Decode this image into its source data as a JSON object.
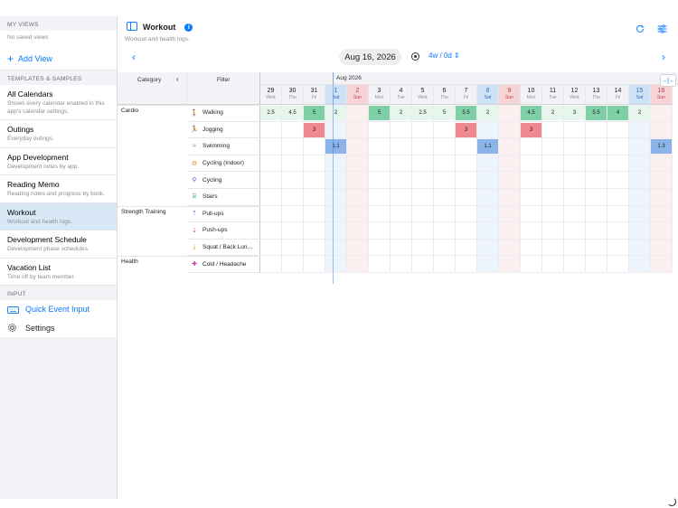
{
  "sidebar": {
    "my_views_header": "MY VIEWS",
    "no_saved_views": "No saved views",
    "add_view": "Add View",
    "templates_header": "TEMPLATES & SAMPLES",
    "items": [
      {
        "name": "All Calendars",
        "desc": "Shows every calendar enabled in this app's calendar settings."
      },
      {
        "name": "Outings",
        "desc": "Everyday outings."
      },
      {
        "name": "App Development",
        "desc": "Development notes by app."
      },
      {
        "name": "Reading Memo",
        "desc": "Reading notes and progress by book."
      },
      {
        "name": "Workout",
        "desc": "Workout and health logs."
      },
      {
        "name": "Development Schedule",
        "desc": "Development phase schedules."
      },
      {
        "name": "Vacation List",
        "desc": "Time off by team member."
      }
    ],
    "selected_index": 4,
    "input_header": "INPUT",
    "quick_event_input": "Quick Event Input",
    "settings": "Settings"
  },
  "header": {
    "title": "Workout",
    "subtitle": "Workout and health logs.",
    "date": "Aug 16, 2026",
    "range": "4w / 0d",
    "icons": [
      "sidebar-toggle-icon",
      "info-icon",
      "refresh-icon",
      "filter-settings-icon"
    ]
  },
  "grid": {
    "category_header": "Category",
    "filter_header": "Filter",
    "month_label": "Aug 2026",
    "days": [
      {
        "num": "29",
        "wd": "Wed",
        "type": "weekday"
      },
      {
        "num": "30",
        "wd": "Thu",
        "type": "weekday"
      },
      {
        "num": "31",
        "wd": "Fri",
        "type": "weekday"
      },
      {
        "num": "1",
        "wd": "Sat",
        "type": "sat"
      },
      {
        "num": "2",
        "wd": "Sun",
        "type": "sun"
      },
      {
        "num": "3",
        "wd": "Mon",
        "type": "weekday"
      },
      {
        "num": "4",
        "wd": "Tue",
        "type": "weekday"
      },
      {
        "num": "5",
        "wd": "Wed",
        "type": "weekday"
      },
      {
        "num": "6",
        "wd": "Thu",
        "type": "weekday"
      },
      {
        "num": "7",
        "wd": "Fri",
        "type": "weekday"
      },
      {
        "num": "8",
        "wd": "Sat",
        "type": "sat"
      },
      {
        "num": "9",
        "wd": "Sun",
        "type": "sun"
      },
      {
        "num": "10",
        "wd": "Mon",
        "type": "weekday"
      },
      {
        "num": "11",
        "wd": "Tue",
        "type": "weekday"
      },
      {
        "num": "12",
        "wd": "Wed",
        "type": "weekday"
      },
      {
        "num": "13",
        "wd": "Thu",
        "type": "weekday"
      },
      {
        "num": "14",
        "wd": "Fri",
        "type": "weekday"
      },
      {
        "num": "15",
        "wd": "Sat",
        "type": "sat"
      },
      {
        "num": "16",
        "wd": "Sun",
        "type": "sun"
      }
    ],
    "rows": [
      {
        "category": "Cardio",
        "filter": "Walking",
        "icon": "walking-icon",
        "icon_color": "#2a9d63"
      },
      {
        "category": "",
        "filter": "Jogging",
        "icon": "running-icon",
        "icon_color": "#e0484f"
      },
      {
        "category": "",
        "filter": "Swimming",
        "icon": "swimming-icon",
        "icon_color": "#3b7fd6"
      },
      {
        "category": "",
        "filter": "Cycling (Indoor)",
        "icon": "indoor-cycling-icon",
        "icon_color": "#e8902a"
      },
      {
        "category": "",
        "filter": "Cycling",
        "icon": "bicycle-icon",
        "icon_color": "#7b4bd6"
      },
      {
        "category": "",
        "filter": "Stairs",
        "icon": "stairs-icon",
        "icon_color": "#2a9d63"
      },
      {
        "category": "Strength Training",
        "filter": "Pull-ups",
        "icon": "pullup-icon",
        "icon_color": "#3b7fd6"
      },
      {
        "category": "",
        "filter": "Push-ups",
        "icon": "pushup-icon",
        "icon_color": "#e0484f"
      },
      {
        "category": "",
        "filter": "Squat / Back Lun…",
        "icon": "squat-icon",
        "icon_color": "#e8902a"
      },
      {
        "category": "Health",
        "filter": "Cold / Headache",
        "icon": "medical-kit-icon",
        "icon_color": "#c0399a"
      }
    ],
    "events": [
      {
        "row": 0,
        "day": 0,
        "value": "2.5",
        "color": "greenlite"
      },
      {
        "row": 0,
        "day": 1,
        "value": "4.5",
        "color": "greenlite"
      },
      {
        "row": 0,
        "day": 2,
        "value": "5",
        "color": "green"
      },
      {
        "row": 0,
        "day": 3,
        "value": "2",
        "color": "greenlite"
      },
      {
        "row": 0,
        "day": 5,
        "value": "5",
        "color": "green"
      },
      {
        "row": 0,
        "day": 6,
        "value": "2",
        "color": "greenlite"
      },
      {
        "row": 0,
        "day": 7,
        "value": "2.5",
        "color": "greenlite"
      },
      {
        "row": 0,
        "day": 8,
        "value": "5",
        "color": "greenlite"
      },
      {
        "row": 0,
        "day": 9,
        "value": "5.5",
        "color": "green"
      },
      {
        "row": 0,
        "day": 10,
        "value": "2",
        "color": "greenlite"
      },
      {
        "row": 0,
        "day": 12,
        "value": "4.5",
        "color": "green"
      },
      {
        "row": 0,
        "day": 13,
        "value": "2",
        "color": "greenlite"
      },
      {
        "row": 0,
        "day": 14,
        "value": "3",
        "color": "greenlite"
      },
      {
        "row": 0,
        "day": 15,
        "value": "5.5",
        "color": "green"
      },
      {
        "row": 0,
        "day": 16,
        "value": "4",
        "color": "green"
      },
      {
        "row": 0,
        "day": 17,
        "value": "2",
        "color": "greenlite"
      },
      {
        "row": 1,
        "day": 2,
        "value": "3",
        "color": "red"
      },
      {
        "row": 1,
        "day": 9,
        "value": "3",
        "color": "red"
      },
      {
        "row": 1,
        "day": 12,
        "value": "3",
        "color": "red"
      },
      {
        "row": 2,
        "day": 3,
        "value": "1.1",
        "color": "blue"
      },
      {
        "row": 2,
        "day": 10,
        "value": "1.1",
        "color": "blue"
      },
      {
        "row": 2,
        "day": 18,
        "value": "1.3",
        "color": "blue"
      }
    ]
  }
}
